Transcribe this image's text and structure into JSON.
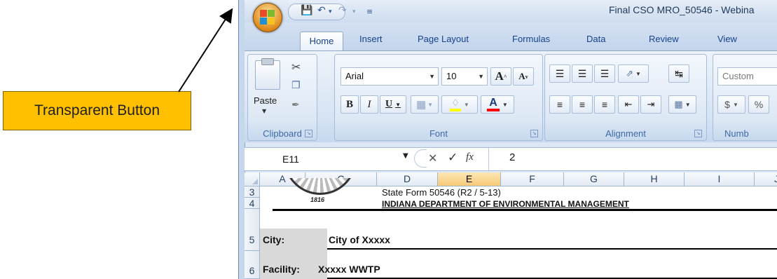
{
  "callout": {
    "label": "Transparent Button"
  },
  "window": {
    "title": "Final CSO MRO_50546 - Webina"
  },
  "ribbon": {
    "tabs": [
      "Home",
      "Insert",
      "Page Layout",
      "Formulas",
      "Data",
      "Review",
      "View"
    ],
    "active_tab": "Home",
    "clipboard": {
      "paste_label": "Paste",
      "group_label": "Clipboard"
    },
    "font": {
      "font_name": "Arial",
      "font_size": "10",
      "bold": "B",
      "italic": "I",
      "underline": "U",
      "grow": "A",
      "shrink": "A",
      "color_a": "A",
      "group_label": "Font",
      "font_color": "#ff0000",
      "fill_color": "#ffff00"
    },
    "alignment": {
      "group_label": "Alignment"
    },
    "number": {
      "format": "Custom",
      "currency": "$",
      "percent": "%",
      "group_label": "Numb"
    }
  },
  "formula_bar": {
    "name_box": "E11",
    "cancel": "✕",
    "enter": "✓",
    "fx": "fx",
    "value": "2"
  },
  "grid": {
    "columns": [
      "A",
      "C",
      "D",
      "E",
      "F",
      "G",
      "H",
      "I",
      "J"
    ],
    "selected_column": "E",
    "rows": [
      {
        "num": "3",
        "text": "State Form 50546 (R2 / 5-13)"
      },
      {
        "num": "4",
        "text": "INDIANA DEPARTMENT OF ENVIRONMENTAL MANAGEMENT"
      },
      {
        "num": "5",
        "label": "City:",
        "value": "City of Xxxxx"
      },
      {
        "num": "6",
        "label": "Facility:",
        "value": "Xxxxx WWTP"
      }
    ],
    "seal_text": "1816"
  }
}
